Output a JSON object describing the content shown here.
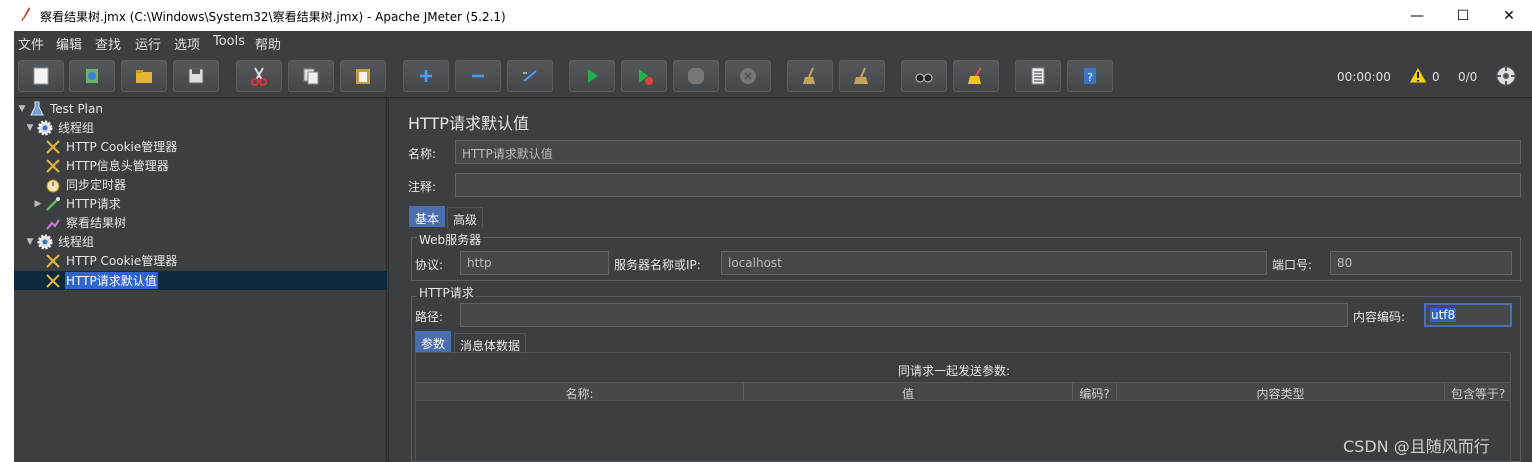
{
  "window": {
    "title": "察看结果树.jmx (C:\\Windows\\System32\\察看结果树.jmx) - Apache JMeter (5.2.1)",
    "minimize": "—",
    "maximize": "☐",
    "close": "✕"
  },
  "menu": [
    "文件",
    "编辑",
    "查找",
    "运行",
    "选项",
    "Tools",
    "帮助"
  ],
  "toolbar": {
    "timer": "00:00:00",
    "warnings": "0",
    "threads": "0/0"
  },
  "tree": {
    "nodes": [
      {
        "label": "Test Plan",
        "icon": "flask-icon"
      },
      {
        "label": "线程组",
        "icon": "gear-icon"
      },
      {
        "label": "HTTP Cookie管理器",
        "icon": "wrench-icon"
      },
      {
        "label": "HTTP信息头管理器",
        "icon": "wrench-icon"
      },
      {
        "label": "同步定时器",
        "icon": "stopwatch-icon"
      },
      {
        "label": "HTTP请求",
        "icon": "pipette-icon"
      },
      {
        "label": "察看结果树",
        "icon": "chart-icon"
      },
      {
        "label": "线程组",
        "icon": "gear-icon"
      },
      {
        "label": "HTTP Cookie管理器",
        "icon": "wrench-icon"
      },
      {
        "label": "HTTP请求默认值",
        "icon": "wrench-icon"
      }
    ]
  },
  "panel": {
    "title": "HTTP请求默认值",
    "name_label": "名称:",
    "name_value": "HTTP请求默认值",
    "comment_label": "注释:",
    "comment_value": "",
    "tabs": [
      "基本",
      "高级"
    ],
    "web_server": {
      "group_title": "Web服务器",
      "protocol_label": "协议:",
      "protocol_value": "http",
      "server_label": "服务器名称或IP:",
      "server_value": "localhost",
      "port_label": "端口号:",
      "port_value": "80"
    },
    "http_request": {
      "group_title": "HTTP请求",
      "path_label": "路径:",
      "path_value": "",
      "encoding_label": "内容编码:",
      "encoding_value": "utf8"
    },
    "subtabs": [
      "参数",
      "消息体数据"
    ],
    "params_caption": "同请求一起发送参数:",
    "columns": [
      "名称:",
      "值",
      "编码?",
      "内容类型",
      "包含等于?"
    ]
  },
  "watermark": "CSDN @且随风而行"
}
